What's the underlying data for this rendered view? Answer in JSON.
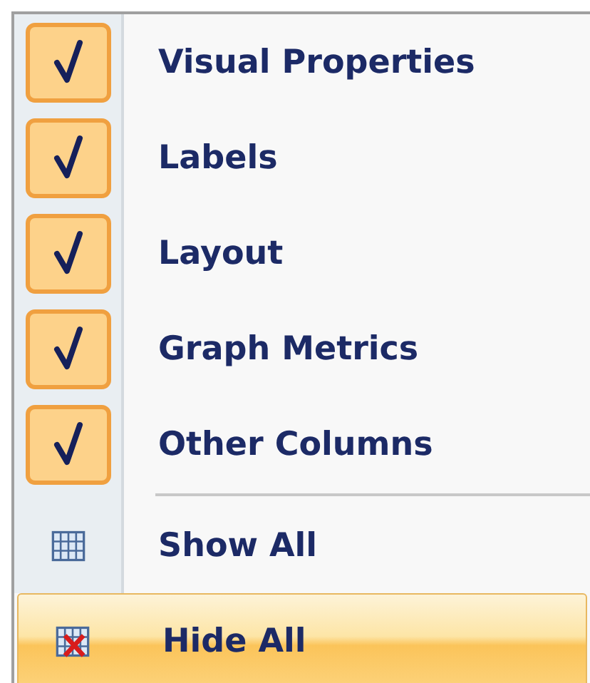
{
  "menu": {
    "items": [
      {
        "kind": "check",
        "label": "Visual Properties",
        "checked": true,
        "highlighted": false
      },
      {
        "kind": "check",
        "label": "Labels",
        "checked": true,
        "highlighted": false
      },
      {
        "kind": "check",
        "label": "Layout",
        "checked": true,
        "highlighted": false
      },
      {
        "kind": "check",
        "label": "Graph Metrics",
        "checked": true,
        "highlighted": false
      },
      {
        "kind": "check",
        "label": "Other Columns",
        "checked": true,
        "highlighted": false
      },
      {
        "kind": "separator"
      },
      {
        "kind": "show",
        "label": "Show All",
        "highlighted": false
      },
      {
        "kind": "hide",
        "label": "Hide All",
        "highlighted": true
      }
    ]
  }
}
